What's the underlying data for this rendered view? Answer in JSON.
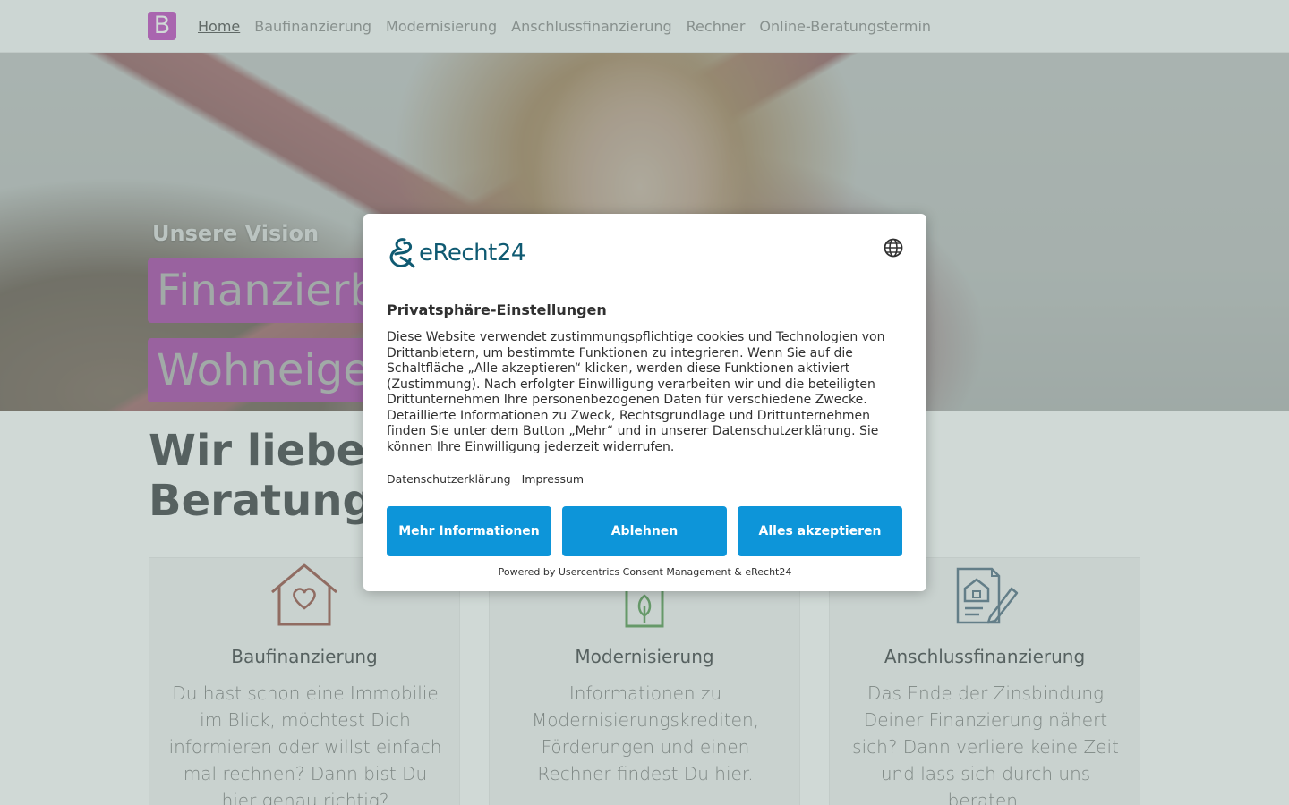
{
  "nav": {
    "brand_letter": "B",
    "items": [
      {
        "label": "Home",
        "active": true
      },
      {
        "label": "Baufinanzierung"
      },
      {
        "label": "Modernisierung"
      },
      {
        "label": "Anschlussfinanzierung"
      },
      {
        "label": "Rechner"
      },
      {
        "label": "Online-Beratungstermin"
      }
    ]
  },
  "hero": {
    "subtitle": "Unsere Vision",
    "line1": "Finanzierbares",
    "line2": "Wohneigentum"
  },
  "section": {
    "heading": "Wir lieben Immobilien und gute Beratung"
  },
  "cards": [
    {
      "icon": "house-heart-icon",
      "title": "Baufinanzierung",
      "text": "Du hast schon eine Immobilie im Blick, möchtest Dich informieren oder willst einfach mal rechnen? Dann bist Du hier genau richtig?"
    },
    {
      "icon": "house-tree-icon",
      "title": "Modernisierung",
      "text": "Informationen zu Modernisierungskrediten, Förderungen und einen Rechner findest Du hier."
    },
    {
      "icon": "document-pen-icon",
      "title": "Anschlussfinanzierung",
      "text": "Das Ende der Zinsbindung Deiner Finanzierung nähert sich? Dann verliere keine Zeit und lass sich durch uns beraten."
    }
  ],
  "consent": {
    "logo_text": "eRecht24",
    "title": "Privatsphäre-Einstellungen",
    "body": "Diese Website verwendet zustimmungspflichtige cookies und Technologien von Drittanbietern, um bestimmte Funktionen zu integrieren. Wenn Sie auf die Schaltfläche „Alle akzeptieren“ klicken, werden diese Funktionen aktiviert (Zustimmung). Nach erfolgter Einwilligung verarbeiten wir und die beteiligten Drittunternehmen Ihre personenbezogenen Daten für verschiedene Zwecke. Detaillierte Informationen zu Zweck, Rechtsgrundlage und Drittunternehmen finden Sie unter dem Button „Mehr“ und in unserer Datenschutzerklärung. Sie können Ihre Einwilligung jederzeit widerrufen.",
    "links": [
      "Datenschutzerklärung",
      "Impressum"
    ],
    "buttons": {
      "more": "Mehr Informationen",
      "deny": "Ablehnen",
      "accept": "Alles akzeptieren"
    },
    "powered": "Powered by Usercentrics Consent Management & eRecht24"
  },
  "colors": {
    "brand": "#b92db8",
    "hero_box": "#9c279b",
    "button": "#0d95d9",
    "logo": "#0f5a72"
  }
}
